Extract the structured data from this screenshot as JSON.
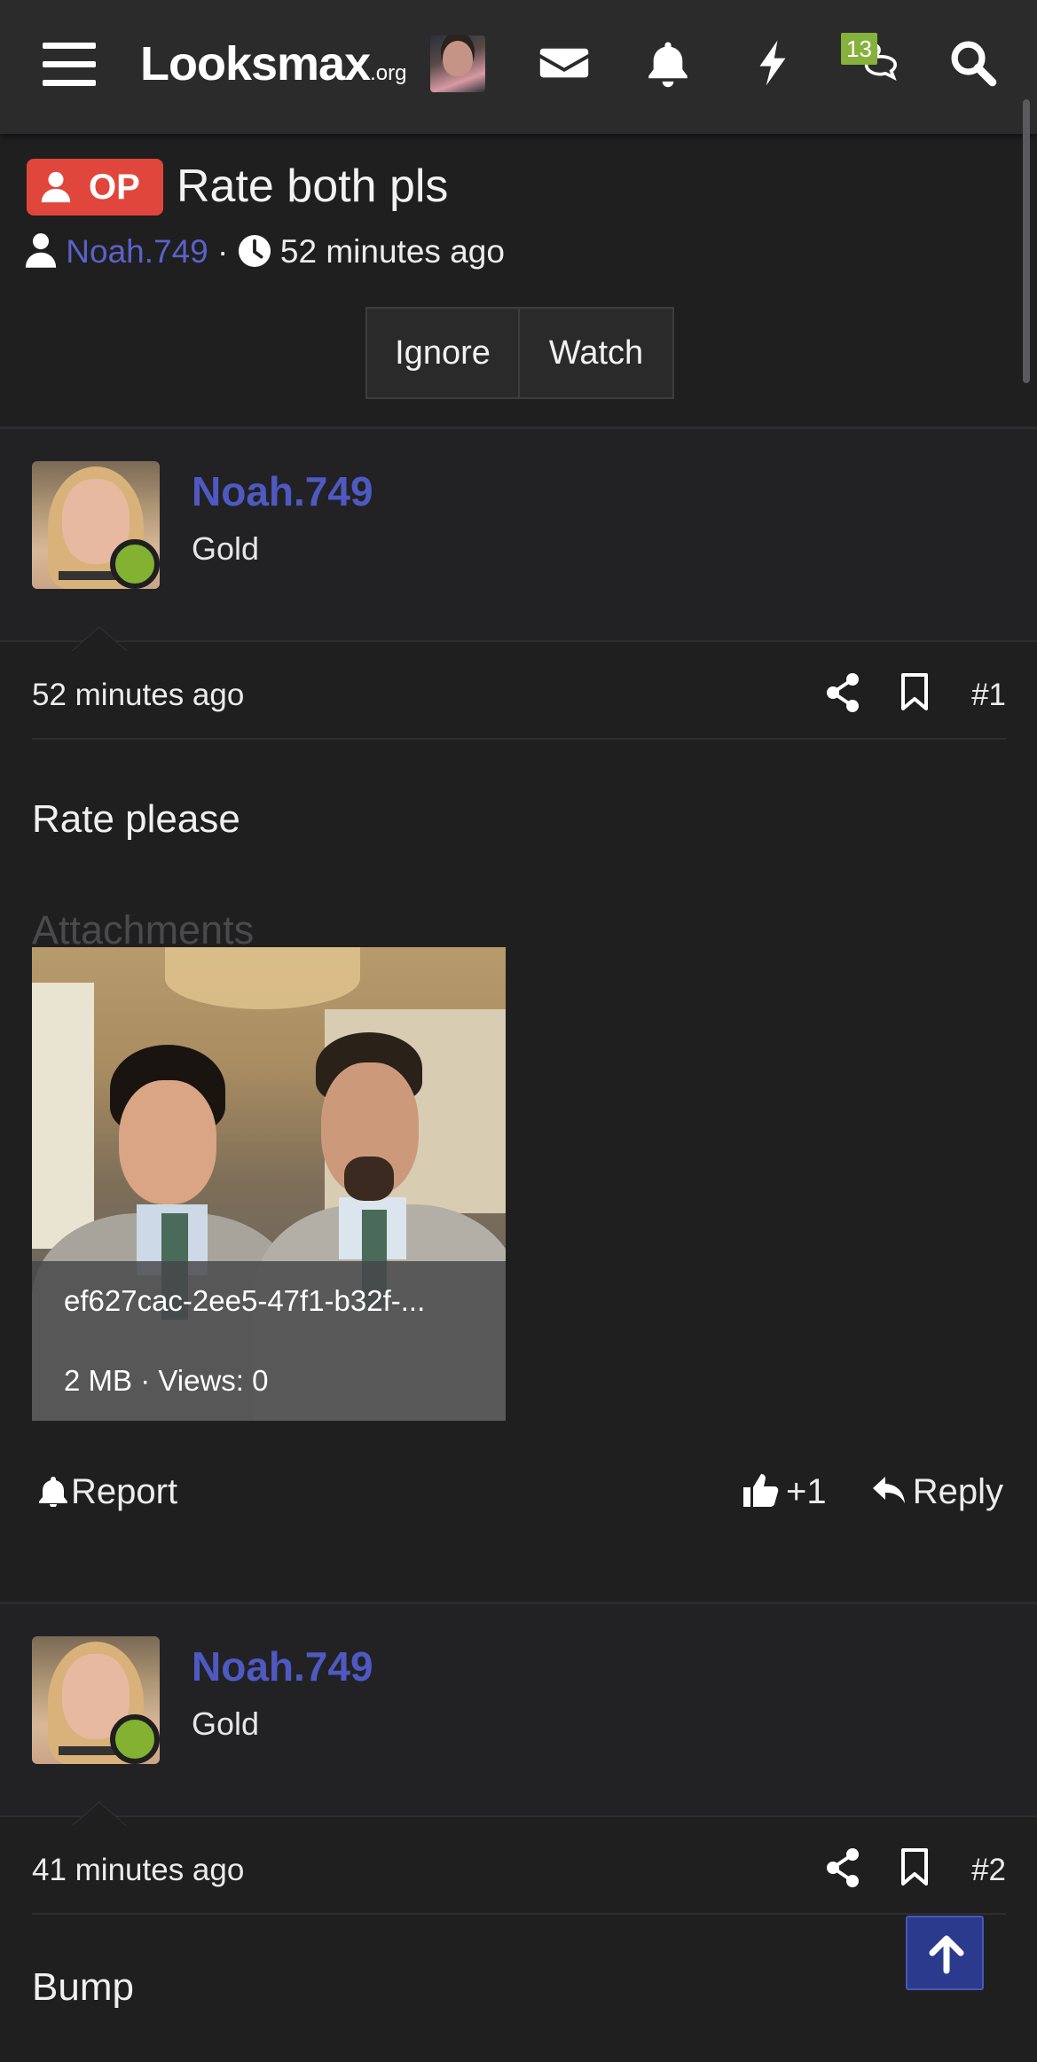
{
  "nav": {
    "logo_main": "Looksmax",
    "logo_tld": ".org",
    "conversations_badge": "13",
    "icons": [
      "menu-icon",
      "mail-icon",
      "bell-icon",
      "bolt-icon",
      "chat-icon",
      "search-icon"
    ]
  },
  "thread": {
    "op_label": "OP",
    "title": "Rate both pls",
    "author": "Noah.749",
    "separator": "·",
    "time": "52 minutes ago",
    "ignore_label": "Ignore",
    "watch_label": "Watch"
  },
  "posts": [
    {
      "username": "Noah.749",
      "rank": "Gold",
      "time": "52 minutes ago",
      "number": "#1",
      "body": "Rate please",
      "attachments_label": "Attachments",
      "attachment": {
        "filename": "ef627cac-2ee5-47f1-b32f-...",
        "info": "2 MB · Views: 0"
      },
      "report_label": "Report",
      "like_label": "+1",
      "reply_label": "Reply"
    },
    {
      "username": "Noah.749",
      "rank": "Gold",
      "time": "41 minutes ago",
      "number": "#2",
      "body": "Bump"
    }
  ],
  "colors": {
    "background": "#1f1f20",
    "topbar": "#2b2b2c",
    "username_blue": "#4f59c2",
    "op_red": "#e0463c",
    "online_green": "#83b232",
    "badge_green": "#86b13c",
    "scroll_top_blue": "#2b3a8c"
  }
}
